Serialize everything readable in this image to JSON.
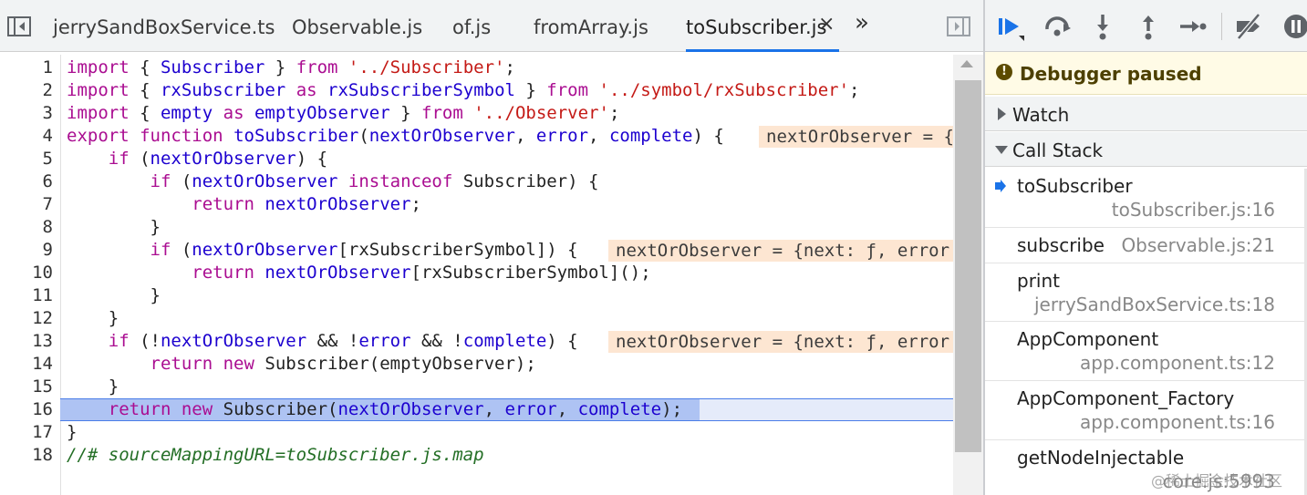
{
  "tabs": [
    {
      "label": "jerrySandBoxService.ts"
    },
    {
      "label": "Observable.js"
    },
    {
      "label": "of.js"
    },
    {
      "label": "fromArray.js"
    },
    {
      "label": "toSubscriber.js",
      "active": true
    }
  ],
  "tab_close_glyph": "×",
  "tab_overflow_glyph": "»",
  "code": {
    "line_numbers": [
      "1",
      "2",
      "3",
      "4",
      "5",
      "6",
      "7",
      "8",
      "9",
      "10",
      "11",
      "12",
      "13",
      "14",
      "15",
      "16",
      "17",
      "18"
    ],
    "current_line": "16",
    "inline_values": {
      "line4": "nextOrObserver = {",
      "line9": "nextOrObserver = {next: ƒ, error",
      "line13": "nextOrObserver = {next: ƒ, error"
    }
  },
  "debugger": {
    "paused_label": "Debugger paused",
    "paused_icon": "!",
    "watch_label": "Watch",
    "call_stack_label": "Call Stack",
    "frames": [
      {
        "fn": "toSubscriber",
        "loc": "toSubscriber.js:16",
        "current": true
      },
      {
        "fn": "subscribe",
        "loc": "Observable.js:21"
      },
      {
        "fn": "print",
        "loc": "jerrySandBoxService.ts:18"
      },
      {
        "fn": "AppComponent",
        "loc": "app.component.ts:12"
      },
      {
        "fn": "AppComponent_Factory",
        "loc": "app.component.ts:16"
      },
      {
        "fn": "getNodeInjectable",
        "loc": "core.js:5993"
      }
    ]
  },
  "watermark": "@稀土掘金技术社区",
  "colors": {
    "keyword": "#aa0d91",
    "string": "#c41a16",
    "variable": "#1c00cf",
    "comment": "#236e25",
    "inline_value_bg": "#fde6d2",
    "exec_line_bg": "#e5ebfa",
    "exec_highlight": "#aec3f3",
    "paused_banner_bg": "#fffbe6",
    "debug_blue": "#1a73e8"
  },
  "icons": [
    "toggle-navigator-icon",
    "toggle-debugger-sidebar-icon",
    "resume-icon",
    "step-over-icon",
    "step-into-icon",
    "step-out-icon",
    "step-icon",
    "deactivate-breakpoints-icon",
    "pause-on-exceptions-icon"
  ]
}
